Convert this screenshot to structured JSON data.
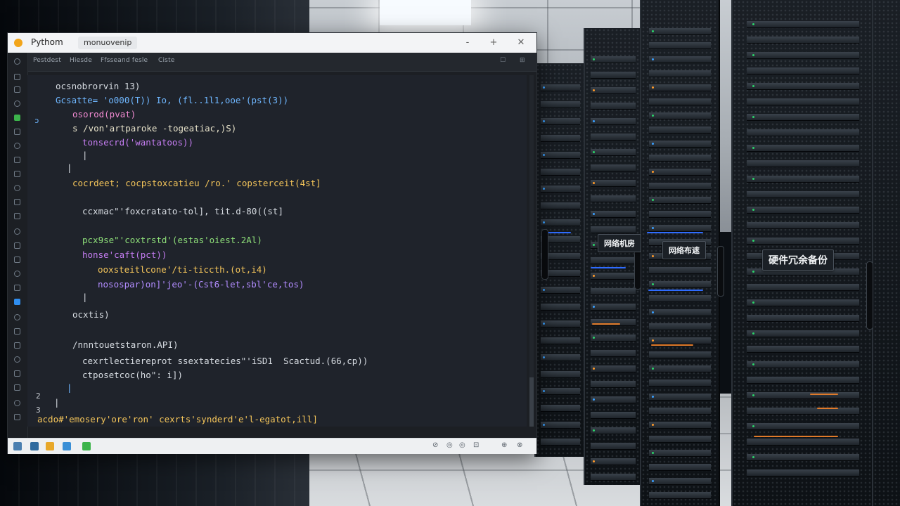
{
  "window": {
    "app_name": "Pythom",
    "tab_name": "monuovenip",
    "controls": {
      "minimize": "-",
      "maximize": "+",
      "close": "✕"
    }
  },
  "menu": [
    "Pestdest",
    "Hiesde",
    "Ffsseand fesle",
    "Ciste"
  ],
  "menu_right": [
    "☐",
    "⊞"
  ],
  "code": [
    {
      "text": "ocsnobrorvin 13)",
      "color": "#d7dce2"
    },
    {
      "text": "Gcsatte= 'o000(T)) Io, (fl..1l1,ooe'(pst(3))",
      "color": "#6fb7ff"
    },
    {
      "text": "osorod(pvat)",
      "color": "#f08ad1"
    },
    {
      "text": "s /von'artparoke -togeatiac,)S)",
      "color": "#e6e1c9"
    },
    {
      "text": "tonsecrd('wantatoos))",
      "color": "#c57df2"
    },
    {
      "text": "|",
      "color": "#d7dce2"
    },
    {
      "text": "|",
      "color": "#d7dce2"
    },
    {
      "text": "cocrdeet; cocpstoxcatieu /ro.' copsterceit(4st]",
      "color": "#f3c45a"
    },
    {
      "text": "ccxmac\"'foxcratato-tol], tit.d-80((st]",
      "color": "#d7dce2"
    },
    {
      "text": "pcx9se\"'coxtrstd'(estas'oiest.2Al)",
      "color": "#8fe07a"
    },
    {
      "text": "honse'caft(pct))",
      "color": "#c57df2"
    },
    {
      "text": "ooxsteitlcone'/ti-ticcth.(ot,i4)",
      "color": "#f3c45a"
    },
    {
      "text": "nosospar)on]'jeo'-(Cst6-let,sbl'ce,tos)",
      "color": "#b28cff"
    },
    {
      "text": "|",
      "color": "#d7dce2"
    },
    {
      "text": "ocxtis)",
      "color": "#d7dce2"
    },
    {
      "text": "/nnntouetstaron.API)",
      "color": "#d7dce2"
    },
    {
      "text": "cexrtlectiereprot ssextatecies\"'iSD1  Scactud.(66,cp))",
      "color": "#d7dce2"
    },
    {
      "text": "ctposetcoc(ho\": i])",
      "color": "#d7dce2"
    },
    {
      "text": "|",
      "color": "#6fb7ff"
    },
    {
      "text": "|",
      "color": "#d7dce2"
    },
    {
      "text": "acdo#'emosery'ore'ron' cexrts'synderd'e'l-egatot,ill]",
      "color": "#f3c45a"
    }
  ],
  "gutter_markers": [
    "ɔ",
    "2",
    "3"
  ],
  "rack_labels": [
    "网络机房",
    "网络布遮",
    "硬件冗余备份"
  ],
  "statusbar_right": [
    "⊘",
    "◎",
    "◎",
    "⊡",
    "⊕",
    "⊗"
  ],
  "colors": {
    "accent_green": "#3cb44b",
    "accent_blue": "#2f8ef0",
    "accent_orange": "#f2a51a"
  }
}
